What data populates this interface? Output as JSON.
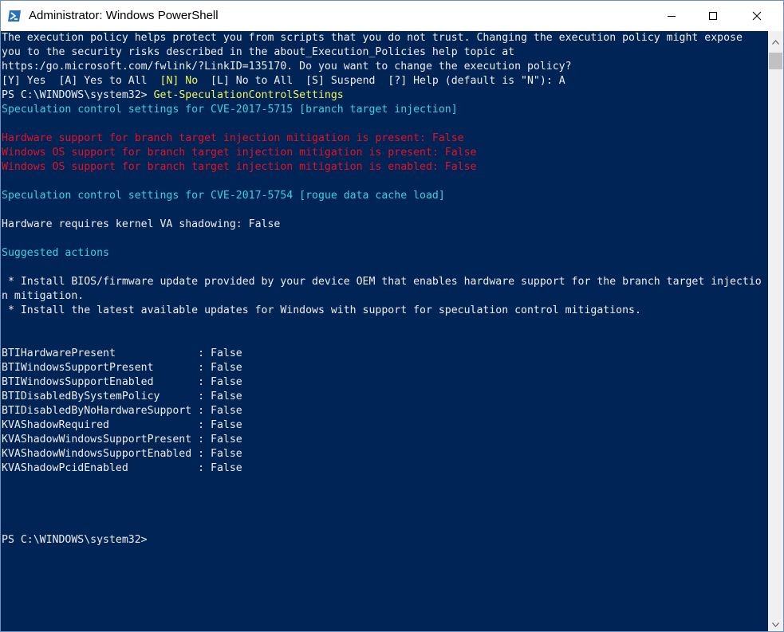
{
  "window": {
    "title": "Administrator: Windows PowerShell",
    "icon": "powershell-icon"
  },
  "caption_buttons": {
    "minimize_icon": "minimize-icon",
    "maximize_icon": "maximize-icon",
    "close_icon": "close-icon"
  },
  "colors": {
    "console_background": "#012456",
    "text_default": "#eeedf0",
    "text_cyan": "#39d2e0",
    "text_red": "#e81123",
    "text_yellow": "#f2f25c"
  },
  "console": {
    "lines": [
      {
        "segments": [
          {
            "text": "The execution policy helps protect you from scripts that you do not trust. Changing the execution policy might expose"
          }
        ]
      },
      {
        "segments": [
          {
            "text": "you to the security risks described in the about_Execution_Policies help topic at"
          }
        ]
      },
      {
        "segments": [
          {
            "text": "https:/go.microsoft.com/fwlink/?LinkID=135170. Do you want to change the execution policy?"
          }
        ]
      },
      {
        "segments": [
          {
            "text": "[Y] Yes  [A] Yes to All  "
          },
          {
            "text": "[N] No",
            "color": "yellow"
          },
          {
            "text": "  [L] No to All  [S] Suspend  [?] Help (default is \"N\"): A"
          }
        ]
      },
      {
        "segments": [
          {
            "text": "PS C:\\WINDOWS\\system32> "
          },
          {
            "text": "Get-SpeculationControlSettings",
            "color": "yellow"
          }
        ]
      },
      {
        "segments": [
          {
            "text": "Speculation control settings for CVE-2017-5715 [branch target injection]",
            "color": "cyan"
          }
        ]
      },
      {
        "segments": [
          {
            "text": ""
          }
        ]
      },
      {
        "segments": [
          {
            "text": "Hardware support for branch target injection mitigation is present: False",
            "color": "red"
          }
        ]
      },
      {
        "segments": [
          {
            "text": "Windows OS support for branch target injection mitigation is present: False",
            "color": "red"
          }
        ]
      },
      {
        "segments": [
          {
            "text": "Windows OS support for branch target injection mitigation is enabled: False",
            "color": "red"
          }
        ]
      },
      {
        "segments": [
          {
            "text": ""
          }
        ]
      },
      {
        "segments": [
          {
            "text": "Speculation control settings for CVE-2017-5754 [rogue data cache load]",
            "color": "cyan"
          }
        ]
      },
      {
        "segments": [
          {
            "text": ""
          }
        ]
      },
      {
        "segments": [
          {
            "text": "Hardware requires kernel VA shadowing: False"
          }
        ]
      },
      {
        "segments": [
          {
            "text": ""
          }
        ]
      },
      {
        "segments": [
          {
            "text": "Suggested actions",
            "color": "cyan"
          }
        ]
      },
      {
        "segments": [
          {
            "text": ""
          }
        ]
      },
      {
        "segments": [
          {
            "text": " * Install BIOS/firmware update provided by your device OEM that enables hardware support for the branch target injectio"
          }
        ]
      },
      {
        "segments": [
          {
            "text": "n mitigation."
          }
        ]
      },
      {
        "segments": [
          {
            "text": " * Install the latest available updates for Windows with support for speculation control mitigations."
          }
        ]
      },
      {
        "segments": [
          {
            "text": ""
          }
        ]
      },
      {
        "segments": [
          {
            "text": ""
          }
        ]
      },
      {
        "segments": [
          {
            "text": "BTIHardwarePresent             : False"
          }
        ]
      },
      {
        "segments": [
          {
            "text": "BTIWindowsSupportPresent       : False"
          }
        ]
      },
      {
        "segments": [
          {
            "text": "BTIWindowsSupportEnabled       : False"
          }
        ]
      },
      {
        "segments": [
          {
            "text": "BTIDisabledBySystemPolicy      : False"
          }
        ]
      },
      {
        "segments": [
          {
            "text": "BTIDisabledByNoHardwareSupport : False"
          }
        ]
      },
      {
        "segments": [
          {
            "text": "KVAShadowRequired              : False"
          }
        ]
      },
      {
        "segments": [
          {
            "text": "KVAShadowWindowsSupportPresent : False"
          }
        ]
      },
      {
        "segments": [
          {
            "text": "KVAShadowWindowsSupportEnabled : False"
          }
        ]
      },
      {
        "segments": [
          {
            "text": "KVAShadowPcidEnabled           : False"
          }
        ]
      },
      {
        "segments": [
          {
            "text": ""
          }
        ]
      },
      {
        "segments": [
          {
            "text": ""
          }
        ]
      },
      {
        "segments": [
          {
            "text": ""
          }
        ]
      },
      {
        "segments": [
          {
            "text": ""
          }
        ]
      },
      {
        "segments": [
          {
            "text": "PS C:\\WINDOWS\\system32>"
          }
        ]
      }
    ]
  },
  "scrollbar": {
    "up_icon": "scroll-up-arrow-icon",
    "down_icon": "scroll-down-arrow-icon"
  }
}
